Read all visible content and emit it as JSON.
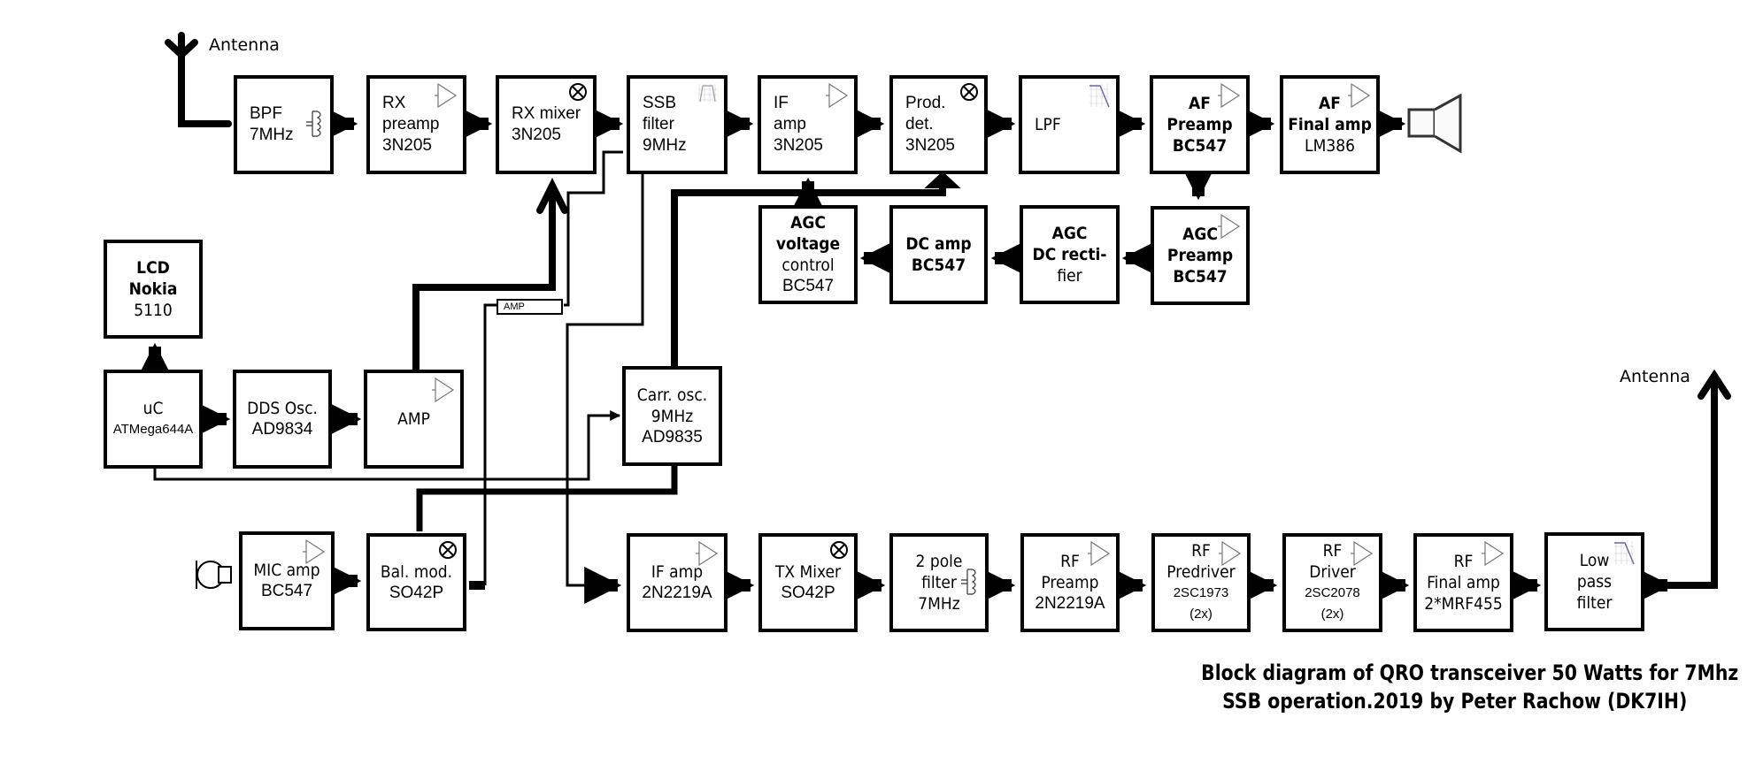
{
  "title": {
    "line1": "Block diagram of QRO transceiver 50 Watts for 7Mhz",
    "line2": "SSB operation.2019 by Peter Rachow (DK7IH)"
  },
  "labels": {
    "rx_antenna": "Antenna",
    "tx_antenna": "Antenna",
    "small_amp": "AMP"
  },
  "blocks": {
    "bpf": {
      "lines": [
        "BPF",
        "7MHz"
      ],
      "icon": "lc-tank-icon"
    },
    "rx_preamp": {
      "lines": [
        "RX",
        "preamp",
        "3N205"
      ],
      "icon": "amplifier-icon"
    },
    "rx_mixer": {
      "lines": [
        "RX mixer",
        "3N205"
      ],
      "icon": "mixer-icon"
    },
    "ssb_filter": {
      "lines": [
        "SSB",
        "filter",
        "9MHz"
      ],
      "icon": "bandpass-response-icon"
    },
    "if_amp_rx": {
      "lines": [
        "IF",
        "amp",
        "3N205"
      ],
      "icon": "amplifier-icon"
    },
    "prod_det": {
      "lines": [
        "Prod.",
        "det.",
        "3N205"
      ],
      "icon": "mixer-icon"
    },
    "lpf_rx": {
      "lines": [
        "LPF"
      ],
      "icon": "lowpass-response-icon"
    },
    "af_preamp": {
      "lines": [
        "AF",
        "Preamp",
        "BC547"
      ],
      "icon": "amplifier-icon"
    },
    "af_final": {
      "lines": [
        "AF",
        "Final amp",
        "LM386"
      ],
      "icon": "amplifier-icon"
    },
    "agc_vc": {
      "lines": [
        "AGC",
        "voltage",
        "control",
        "BC547"
      ]
    },
    "dc_amp": {
      "lines": [
        "DC amp",
        "BC547"
      ]
    },
    "agc_rect": {
      "lines": [
        "AGC",
        "DC recti-",
        "fier"
      ]
    },
    "agc_preamp": {
      "lines": [
        "AGC",
        "Preamp",
        "BC547"
      ],
      "icon": "amplifier-icon"
    },
    "lcd": {
      "lines": [
        "LCD",
        "Nokia",
        "5110"
      ]
    },
    "uc": {
      "lines": [
        "uC",
        "ATMega644A"
      ]
    },
    "dds": {
      "lines": [
        "DDS Osc.",
        "AD9834"
      ]
    },
    "vfo_amp": {
      "lines": [
        "AMP"
      ],
      "icon": "amplifier-icon"
    },
    "carr_osc": {
      "lines": [
        "Carr. osc.",
        "9MHz",
        "AD9835"
      ]
    },
    "mic_amp": {
      "lines": [
        "MIC amp",
        "BC547"
      ],
      "icon": "amplifier-icon"
    },
    "bal_mod": {
      "lines": [
        "Bal. mod.",
        "SO42P"
      ],
      "icon": "mixer-icon"
    },
    "if_amp_tx": {
      "lines": [
        "IF amp",
        "2N2219A"
      ],
      "icon": "amplifier-icon"
    },
    "tx_mixer": {
      "lines": [
        "TX Mixer",
        "SO42P"
      ],
      "icon": "mixer-icon"
    },
    "two_pole": {
      "lines": [
        "2 pole",
        "filter",
        "7MHz"
      ],
      "icon": "lc-tank-icon"
    },
    "rf_preamp": {
      "lines": [
        "RF",
        "Preamp",
        "2N2219A"
      ],
      "icon": "amplifier-icon"
    },
    "rf_predriver": {
      "lines": [
        "RF",
        "Predriver",
        "2SC1973",
        "(2x)"
      ],
      "icon": "amplifier-icon"
    },
    "rf_driver": {
      "lines": [
        "RF",
        "Driver",
        "2SC2078",
        "(2x)"
      ],
      "icon": "amplifier-icon"
    },
    "rf_final": {
      "lines": [
        "RF",
        "Final amp",
        "2*MRF455"
      ],
      "icon": "amplifier-icon"
    },
    "lpf_tx": {
      "lines": [
        "Low",
        "pass",
        "filter"
      ],
      "icon": "lowpass-response-icon"
    }
  }
}
